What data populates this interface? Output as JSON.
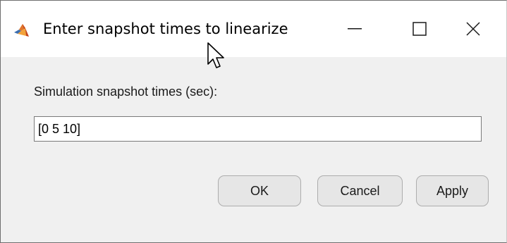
{
  "window": {
    "title": "Enter snapshot times to linearize",
    "icon": "matlab-icon",
    "controls": {
      "minimize_icon": "minimize-icon",
      "maximize_icon": "maximize-icon",
      "close_icon": "close-icon"
    }
  },
  "form": {
    "label": "Simulation snapshot times (sec):",
    "value": "[0 5 10]"
  },
  "buttons": {
    "ok_label": "OK",
    "cancel_label": "Cancel",
    "apply_label": "Apply"
  },
  "colors": {
    "dialog_background": "#f0f0f0",
    "titlebar_background": "#ffffff",
    "button_background": "#e6e6e6",
    "button_border": "#adadad"
  }
}
